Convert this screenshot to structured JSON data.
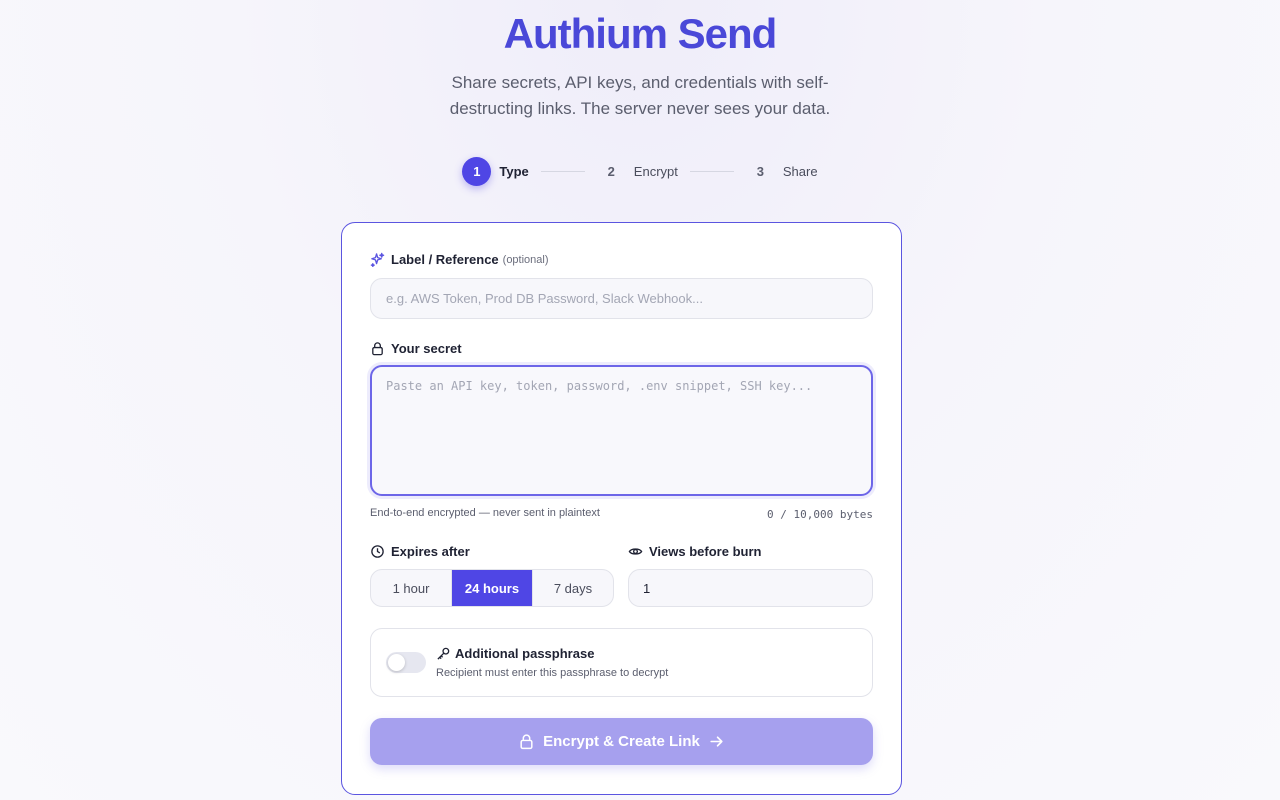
{
  "header": {
    "title": "Authium Send",
    "subtitle_line1": "Share secrets, API keys, and credentials with self-",
    "subtitle_line2": "destructing links. The server never sees your data."
  },
  "steps": [
    {
      "num": "1",
      "label": "Type",
      "active": true
    },
    {
      "num": "2",
      "label": "Encrypt",
      "active": false
    },
    {
      "num": "3",
      "label": "Share",
      "active": false
    }
  ],
  "form": {
    "label_field": {
      "label": "Label / Reference",
      "optional": "(optional)",
      "placeholder": "e.g. AWS Token, Prod DB Password, Slack Webhook..."
    },
    "secret_field": {
      "label": "Your secret",
      "placeholder": "Paste an API key, token, password, .env snippet, SSH key...",
      "hint": "End-to-end encrypted — never sent in plaintext",
      "byte_count": "0 / 10,000 bytes"
    },
    "expires": {
      "label": "Expires after",
      "options": [
        "1 hour",
        "24 hours",
        "7 days"
      ],
      "selected": "24 hours"
    },
    "views": {
      "label": "Views before burn",
      "value": "1"
    },
    "passphrase": {
      "title": "Additional passphrase",
      "subtitle": "Recipient must enter this passphrase to decrypt",
      "enabled": false
    },
    "submit_label": "Encrypt & Create Link"
  },
  "colors": {
    "accent": "#4f46e5",
    "title": "#4a48d8",
    "submit_disabled": "#a6a0ee"
  }
}
